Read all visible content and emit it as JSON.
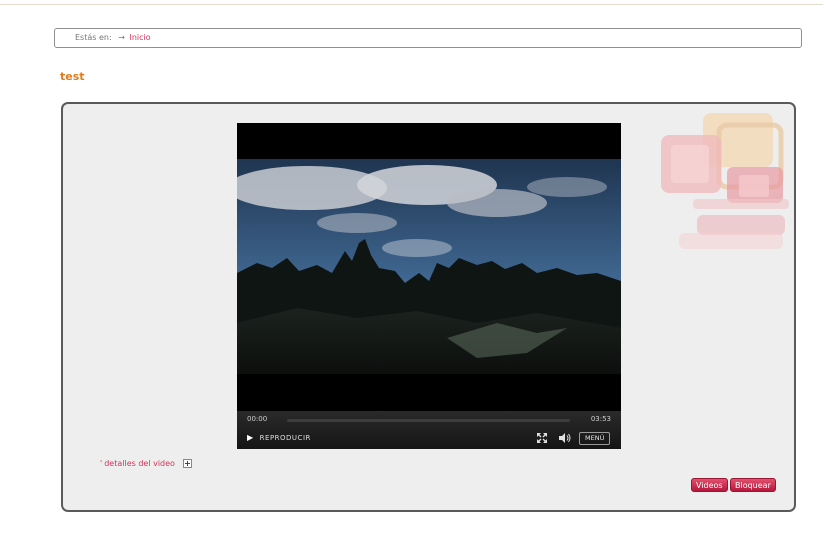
{
  "breadcrumb": {
    "prefix": "Estás en:",
    "arrow": "→",
    "link": "Inicio"
  },
  "page": {
    "title": "test"
  },
  "player": {
    "current_time": "00:00",
    "duration": "03:53",
    "progress_fraction": 0,
    "play_label": "REPRODUCIR",
    "menu_label": "MENÚ"
  },
  "details": {
    "label": "detalles del video"
  },
  "actions": {
    "videos_label": "Videos",
    "bloquear_label": "Bloquear"
  },
  "colors": {
    "accent": "#d0345c",
    "title": "#e07b1c",
    "button": "#c22448"
  }
}
